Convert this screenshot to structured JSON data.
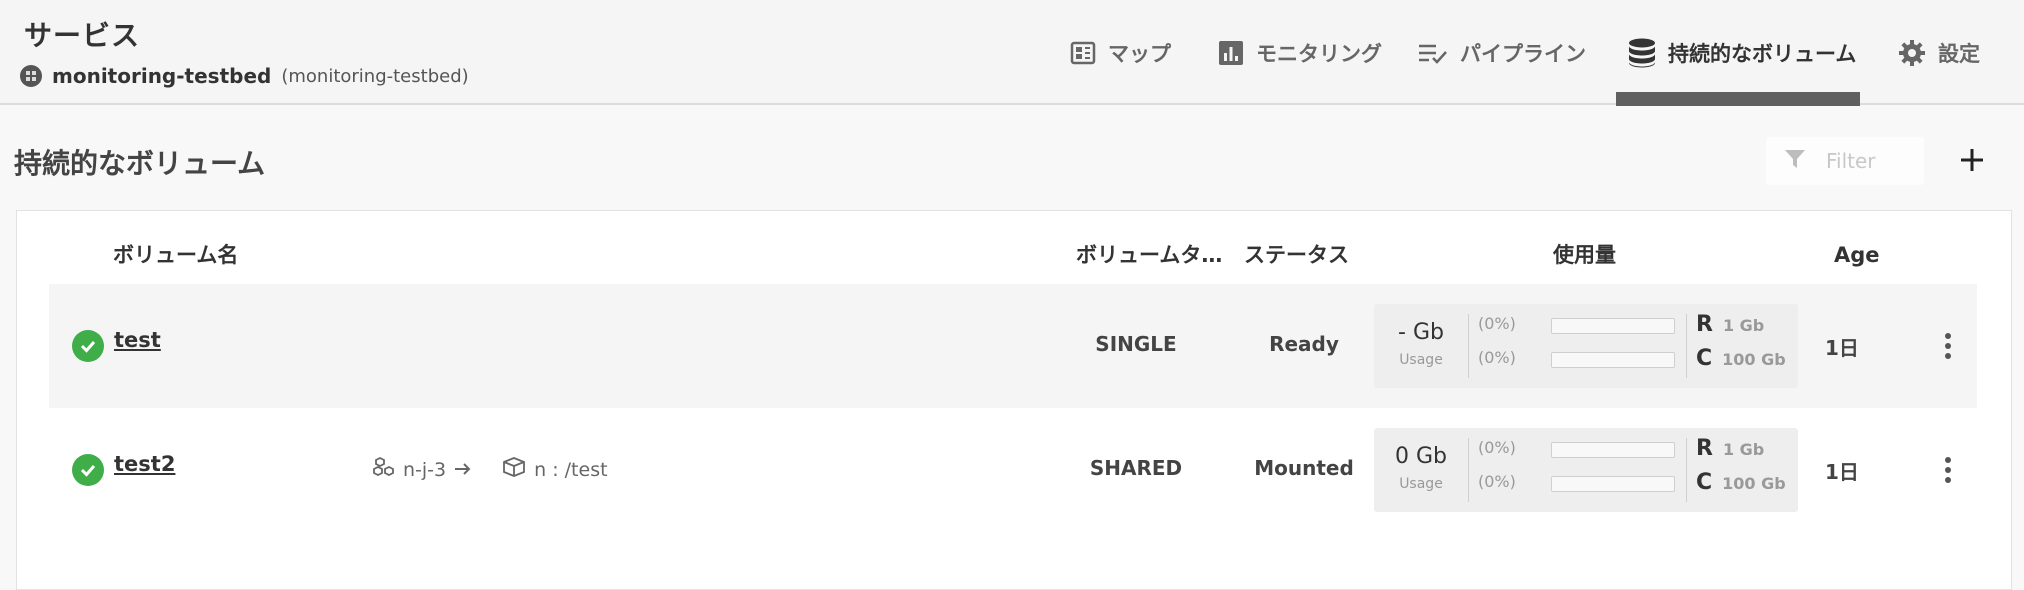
{
  "header": {
    "title": "サービス",
    "service_name": "monitoring-testbed",
    "service_sub": "(monitoring-testbed)"
  },
  "nav": {
    "tabs": [
      {
        "label": "マップ",
        "icon": "map-icon",
        "active": false
      },
      {
        "label": "モニタリング",
        "icon": "chart-icon",
        "active": false
      },
      {
        "label": "パイプライン",
        "icon": "pipeline-icon",
        "active": false
      },
      {
        "label": "持続的なボリューム",
        "icon": "database-icon",
        "active": true
      },
      {
        "label": "設定",
        "icon": "gear-icon",
        "active": false
      }
    ]
  },
  "section": {
    "title": "持続的なボリューム",
    "filter_placeholder": "Filter"
  },
  "table": {
    "headers": {
      "name": "ボリューム名",
      "type": "ボリュームタ…",
      "status": "ステータス",
      "usage": "使用量",
      "age": "Age"
    },
    "rows": [
      {
        "name": "test",
        "status_icon": "check-circle-icon",
        "node": "",
        "mount": "",
        "type": "SINGLE",
        "status": "Ready",
        "usage_value": "- Gb",
        "usage_label": "Usage",
        "read_pct": "(0%)",
        "cap_pct": "(0%)",
        "read_fill": 0,
        "cap_fill": 0,
        "r_label": "R",
        "r_value": "1 Gb",
        "c_label": "C",
        "c_value": "100 Gb",
        "age": "1日"
      },
      {
        "name": "test2",
        "status_icon": "check-circle-icon",
        "node": "n-j-3",
        "mount": "n : /test",
        "type": "SHARED",
        "status": "Mounted",
        "usage_value": "0 Gb",
        "usage_label": "Usage",
        "read_pct": "(0%)",
        "cap_pct": "(0%)",
        "read_fill": 0,
        "cap_fill": 0,
        "r_label": "R",
        "r_value": "1 Gb",
        "c_label": "C",
        "c_value": "100 Gb",
        "age": "1日"
      }
    ]
  },
  "colors": {
    "accent_tab": "#5f5f5f",
    "status_ok": "#3fae49",
    "row_highlight": "#f5f5f5"
  }
}
